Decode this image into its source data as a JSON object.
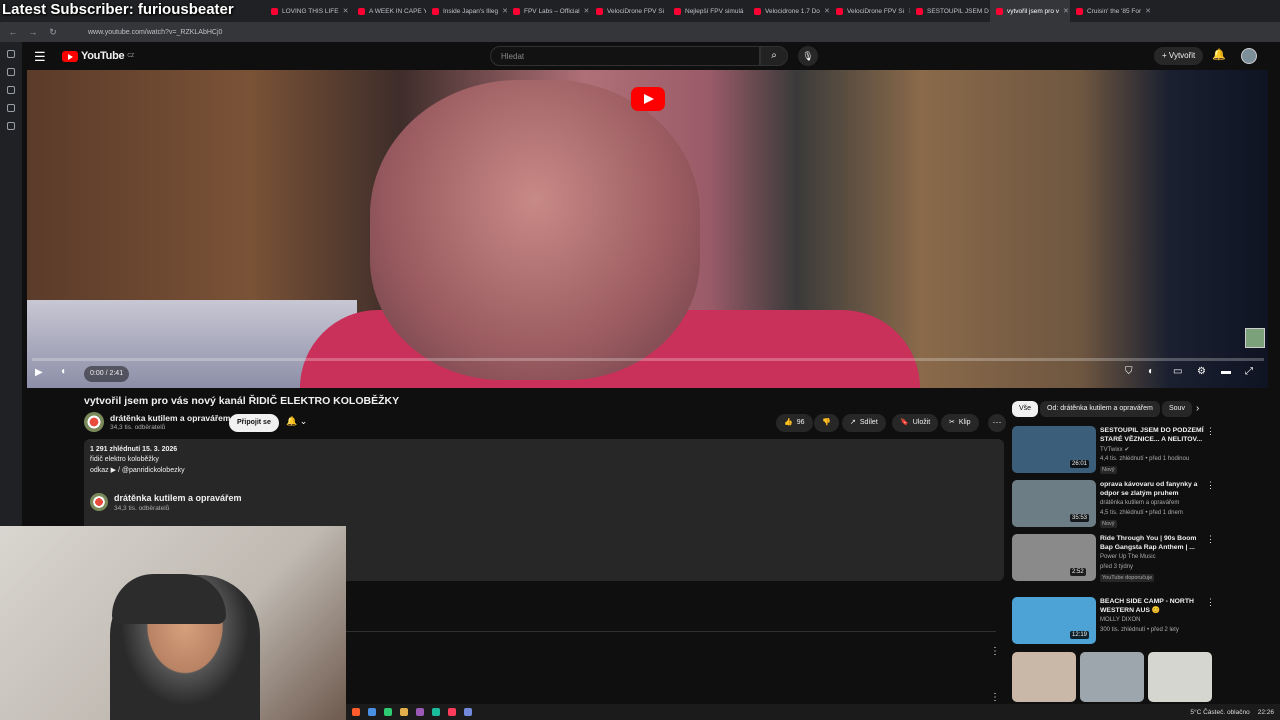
{
  "overlay": {
    "text": "Latest Subscriber: furiousbeater"
  },
  "browser": {
    "tabs": [
      {
        "label": "LOVING THIS LIFE",
        "active": false
      },
      {
        "label": "A WEEK IN CAPE Y",
        "active": false
      },
      {
        "label": "Inside Japan's Illeg",
        "active": false
      },
      {
        "label": "FPV Labs – Official",
        "active": false
      },
      {
        "label": "VelociDrone FPV Si",
        "active": false
      },
      {
        "label": "Nejlepší FPV simulá",
        "active": false
      },
      {
        "label": "Velocidrone 1.7 Do",
        "active": false
      },
      {
        "label": "VelociDrone FPV Si",
        "active": false
      },
      {
        "label": "SESTOUPIL JSEM D",
        "active": false
      },
      {
        "label": "vytvořil jsem pro v",
        "active": true
      },
      {
        "label": "Cruisin' the '85 For",
        "active": false
      }
    ],
    "url": "www.youtube.com/watch?v=_RZKLAbHCj0"
  },
  "youtube": {
    "logo": "YouTube",
    "logo_region": "CZ",
    "search_placeholder": "Hledat",
    "create_label": "Vytvořit"
  },
  "player": {
    "time": "0:00 / 2:41",
    "progress": 0.0
  },
  "video": {
    "title": "vytvořil jsem pro vás nový kanál ŘIDIČ ELEKTRO KOLOBĚŽKY",
    "channel": "drátěnka kutilem a opravářem",
    "subscribers": "34,3 tis. odběratelů",
    "join_label": "Připojit se",
    "likes": "96",
    "share_label": "Sdílet",
    "save_label": "Uložit",
    "clip_label": "Klip"
  },
  "description": {
    "stats": "1 291 zhlédnutí  15. 3. 2026",
    "line1": "řidič elektro koloběžky",
    "line2": "odkaz  ▶ / @panridickolobezky",
    "channel": "drátěnka kutilem a opravářem",
    "subscribers": "34,3 tis. odběratelů"
  },
  "chips": [
    "Vše",
    "Od: drátěnka kutilem a opravářem",
    "Souv"
  ],
  "recommendations": [
    {
      "title": "SESTOUPIL JSEM DO PODZEMÍ STARÉ VĚZNICE... A NELITOV...",
      "channel": "TVTwixx ✔",
      "meta": "4,4 tis. zhlédnutí • před 1 hodinou",
      "badge": "Nový",
      "duration": "26:01",
      "thumb_color": "#3b5e7a"
    },
    {
      "title": "oprava kávovaru od fanynky a odpor se zlatým pruhem",
      "channel": "drátěnka kutilem a opravářem",
      "meta": "4,5 tis. zhlédnutí • před 1 dnem",
      "badge": "Nový",
      "duration": "35:53",
      "thumb_color": "#6d7d86"
    },
    {
      "title": "Ride Through You | 90s Boom Bap Gangsta Rap Anthem | ...",
      "channel": "Power Up The Music",
      "meta": "před 3 týdny",
      "badge": "YouTube doporučuje",
      "duration": "2:52",
      "thumb_color": "#8a8a8a"
    },
    {
      "title": "BEACH SIDE CAMP - NORTH WESTERN AUS 😊",
      "channel": "MOLLY DIXON",
      "meta": "300 tis. zhlédnutí • před 2 lety",
      "badge": "",
      "duration": "12:19",
      "thumb_color": "#4ea3d6"
    }
  ],
  "taskbar": {
    "weather": "5°C  Částeč. oblačno",
    "clock": "22:26"
  }
}
